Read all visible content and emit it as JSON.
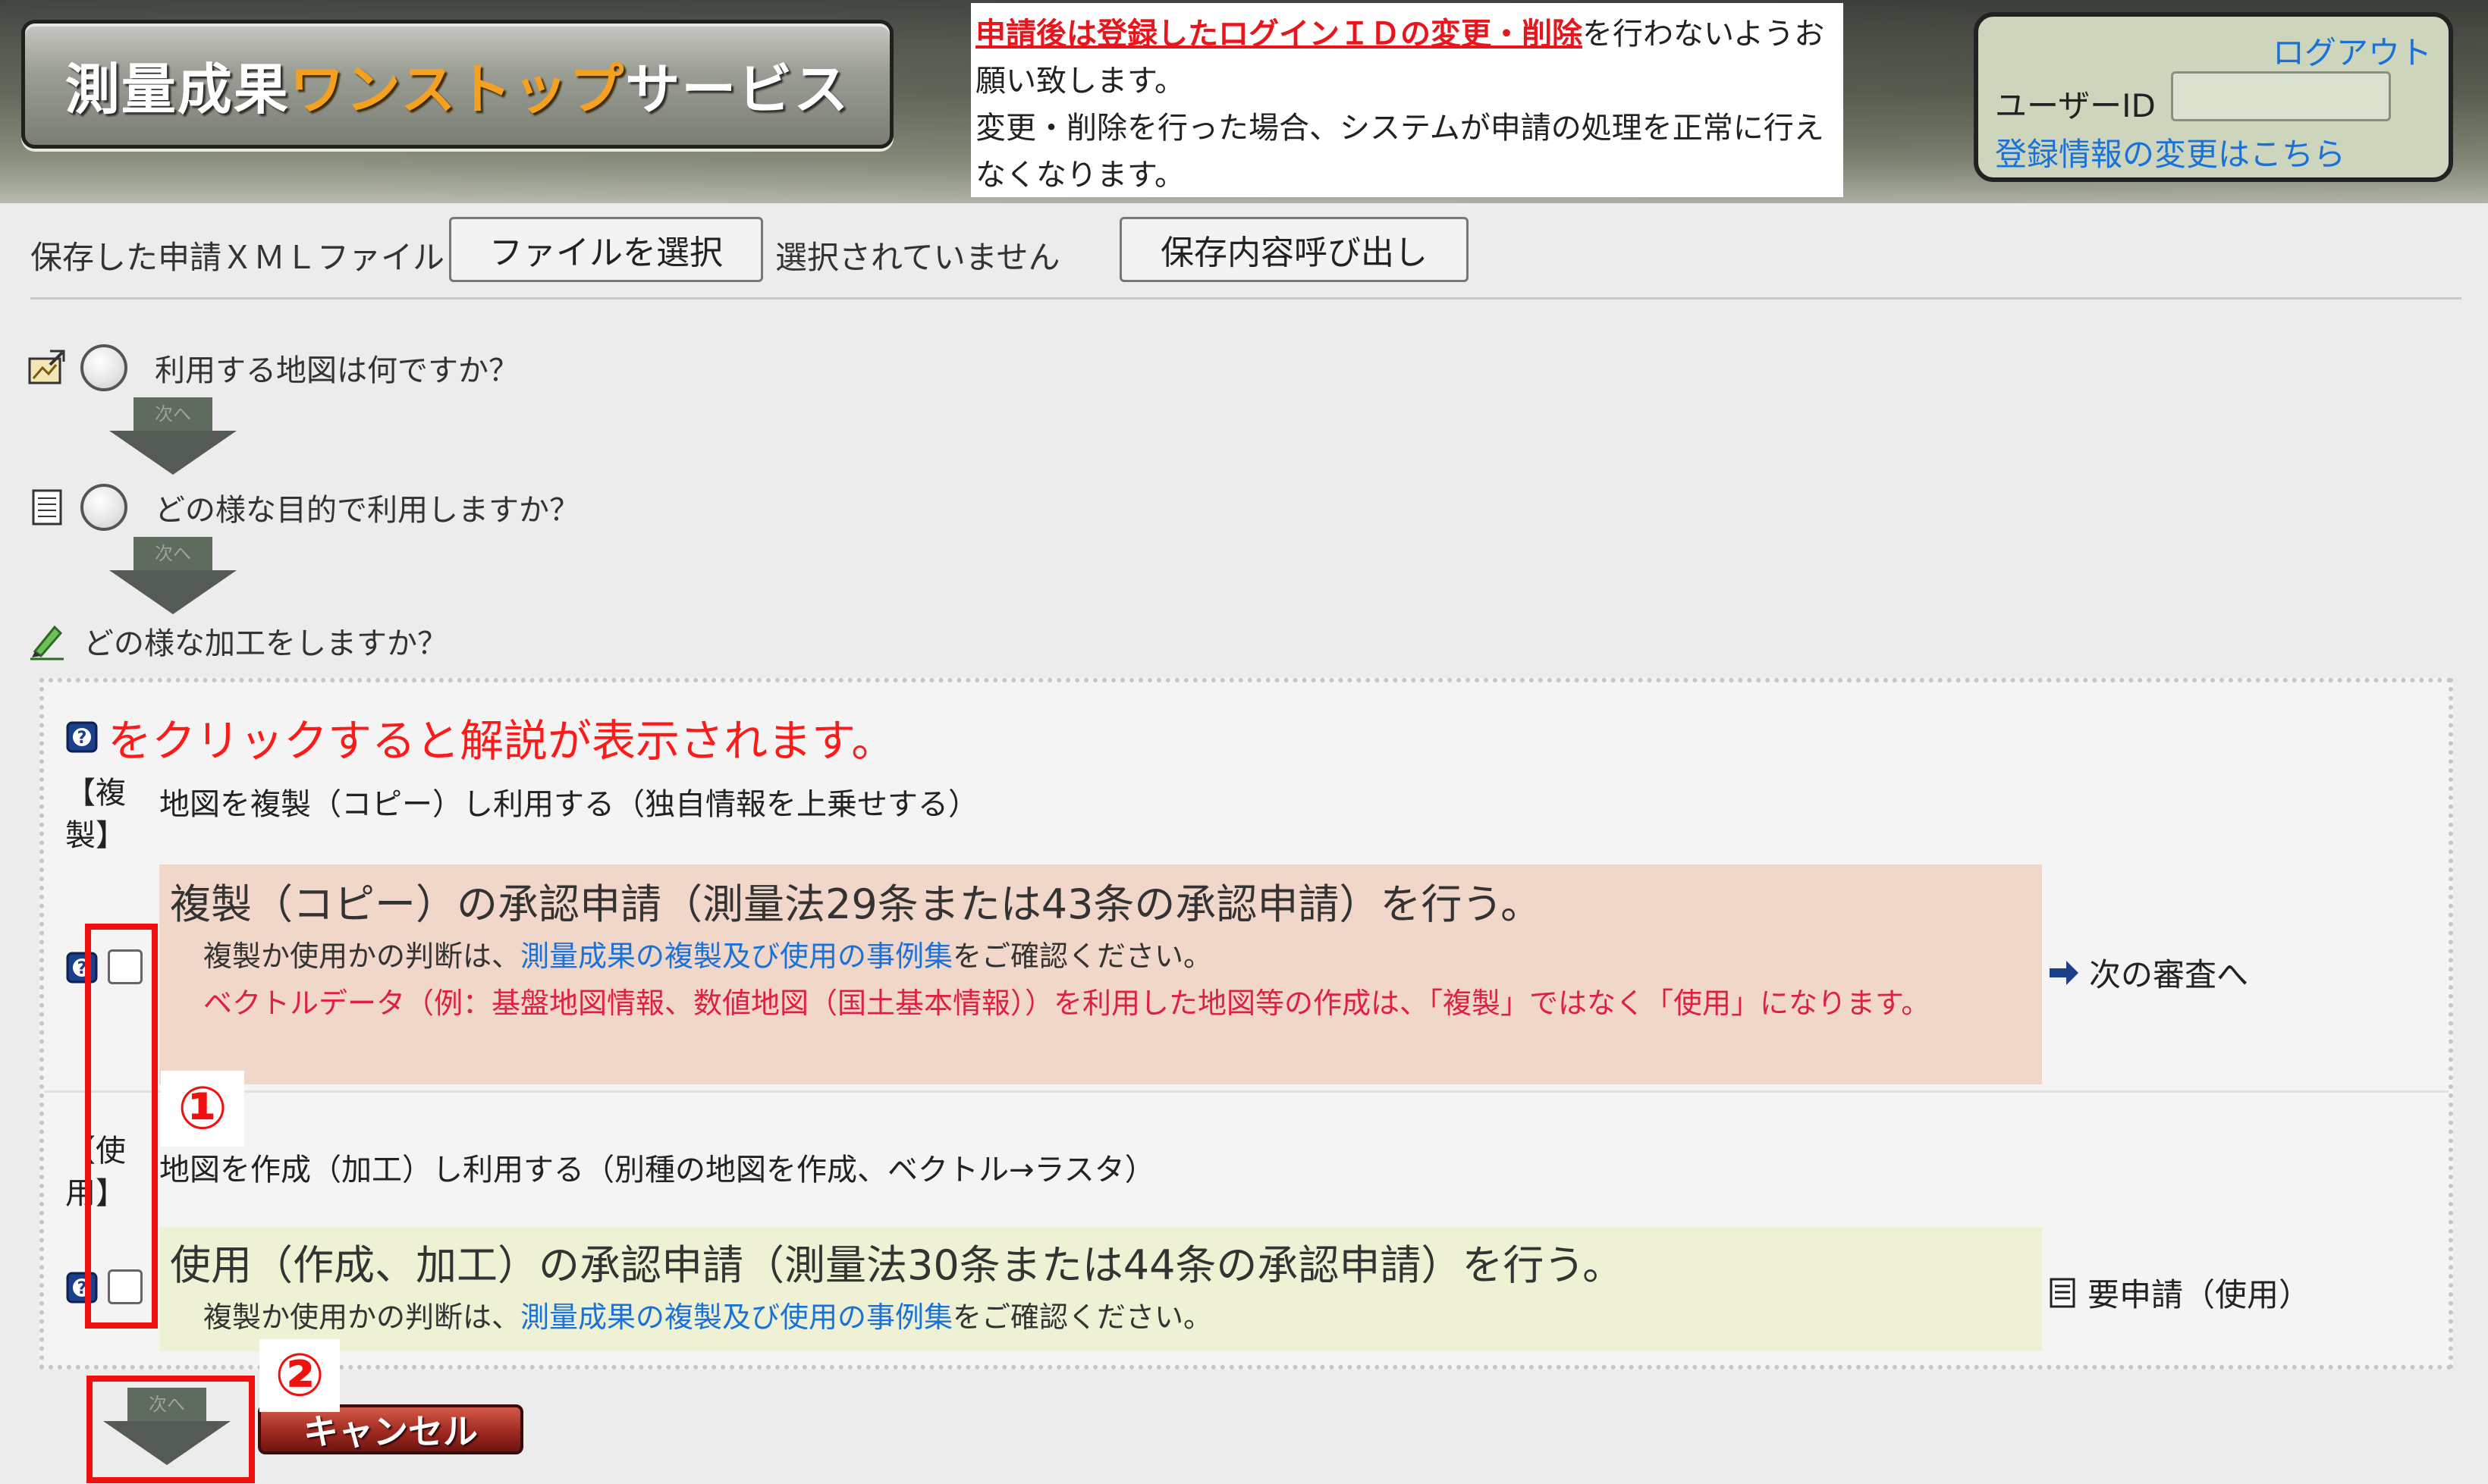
{
  "header": {
    "logo_part1": "測量成果",
    "logo_part2": "ワンストップ",
    "logo_part3": "サービス",
    "notice_warn": "申請後は登録したログインＩＤの変更・削除",
    "notice_rest": "を行わないようお願い致します。",
    "notice_line2": "変更・削除を行った場合、システムが申請の処理を正常に行えなくなります。",
    "logout_label": "ログアウト",
    "userid_label": "ユーザーID",
    "userid_value": "",
    "change_link": "登録情報の変更はこちら"
  },
  "file_row": {
    "label": "保存した申請ＸＭＬファイル",
    "choose_button": "ファイルを選択",
    "no_file_text": "選択されていません",
    "load_button": "保存内容呼び出し"
  },
  "steps": [
    {
      "question": "利用する地図は何ですか？",
      "next_label": "次へ"
    },
    {
      "question": "どの様な目的で利用しますか？",
      "next_label": "次へ"
    },
    {
      "question": "どの様な加工をしますか？"
    }
  ],
  "panel": {
    "hint": "をクリックすると解説が表示されます。",
    "copy": {
      "label": "【複製】",
      "description": "地図を複製（コピー）し利用する（独自情報を上乗せする）",
      "title": "複製（コピー）の承認申請（測量法29条または43条の承認申請）を行う。",
      "line1_pre": "複製か使用かの判断は、",
      "line1_link": "測量成果の複製及び使用の事例集",
      "line1_post": "をご確認ください。",
      "line2": "ベクトルデータ（例：基盤地図情報、数値地図（国土基本情報））を利用した地図等の作成は、「複製」ではなく「使用」になります。",
      "result": "次の審査へ"
    },
    "use": {
      "label": "【使用】",
      "description": "地図を作成（加工）し利用する（別種の地図を作成、ベクトル→ラスタ）",
      "title": "使用（作成、加工）の承認申請（測量法30条または44条の承認申請）を行う。",
      "line1_pre": "複製か使用かの判断は、",
      "line1_link": "測量成果の複製及び使用の事例集",
      "line1_post": "をご確認ください。",
      "result": "要申請（使用）"
    }
  },
  "footer": {
    "next_label": "次へ",
    "cancel_label": "キャンセル"
  },
  "annotations": {
    "badge1": "①",
    "badge2": "②"
  },
  "colors": {
    "accent_red": "#f01010",
    "link_blue": "#1a72d8",
    "logo_orange": "#f4a020"
  }
}
